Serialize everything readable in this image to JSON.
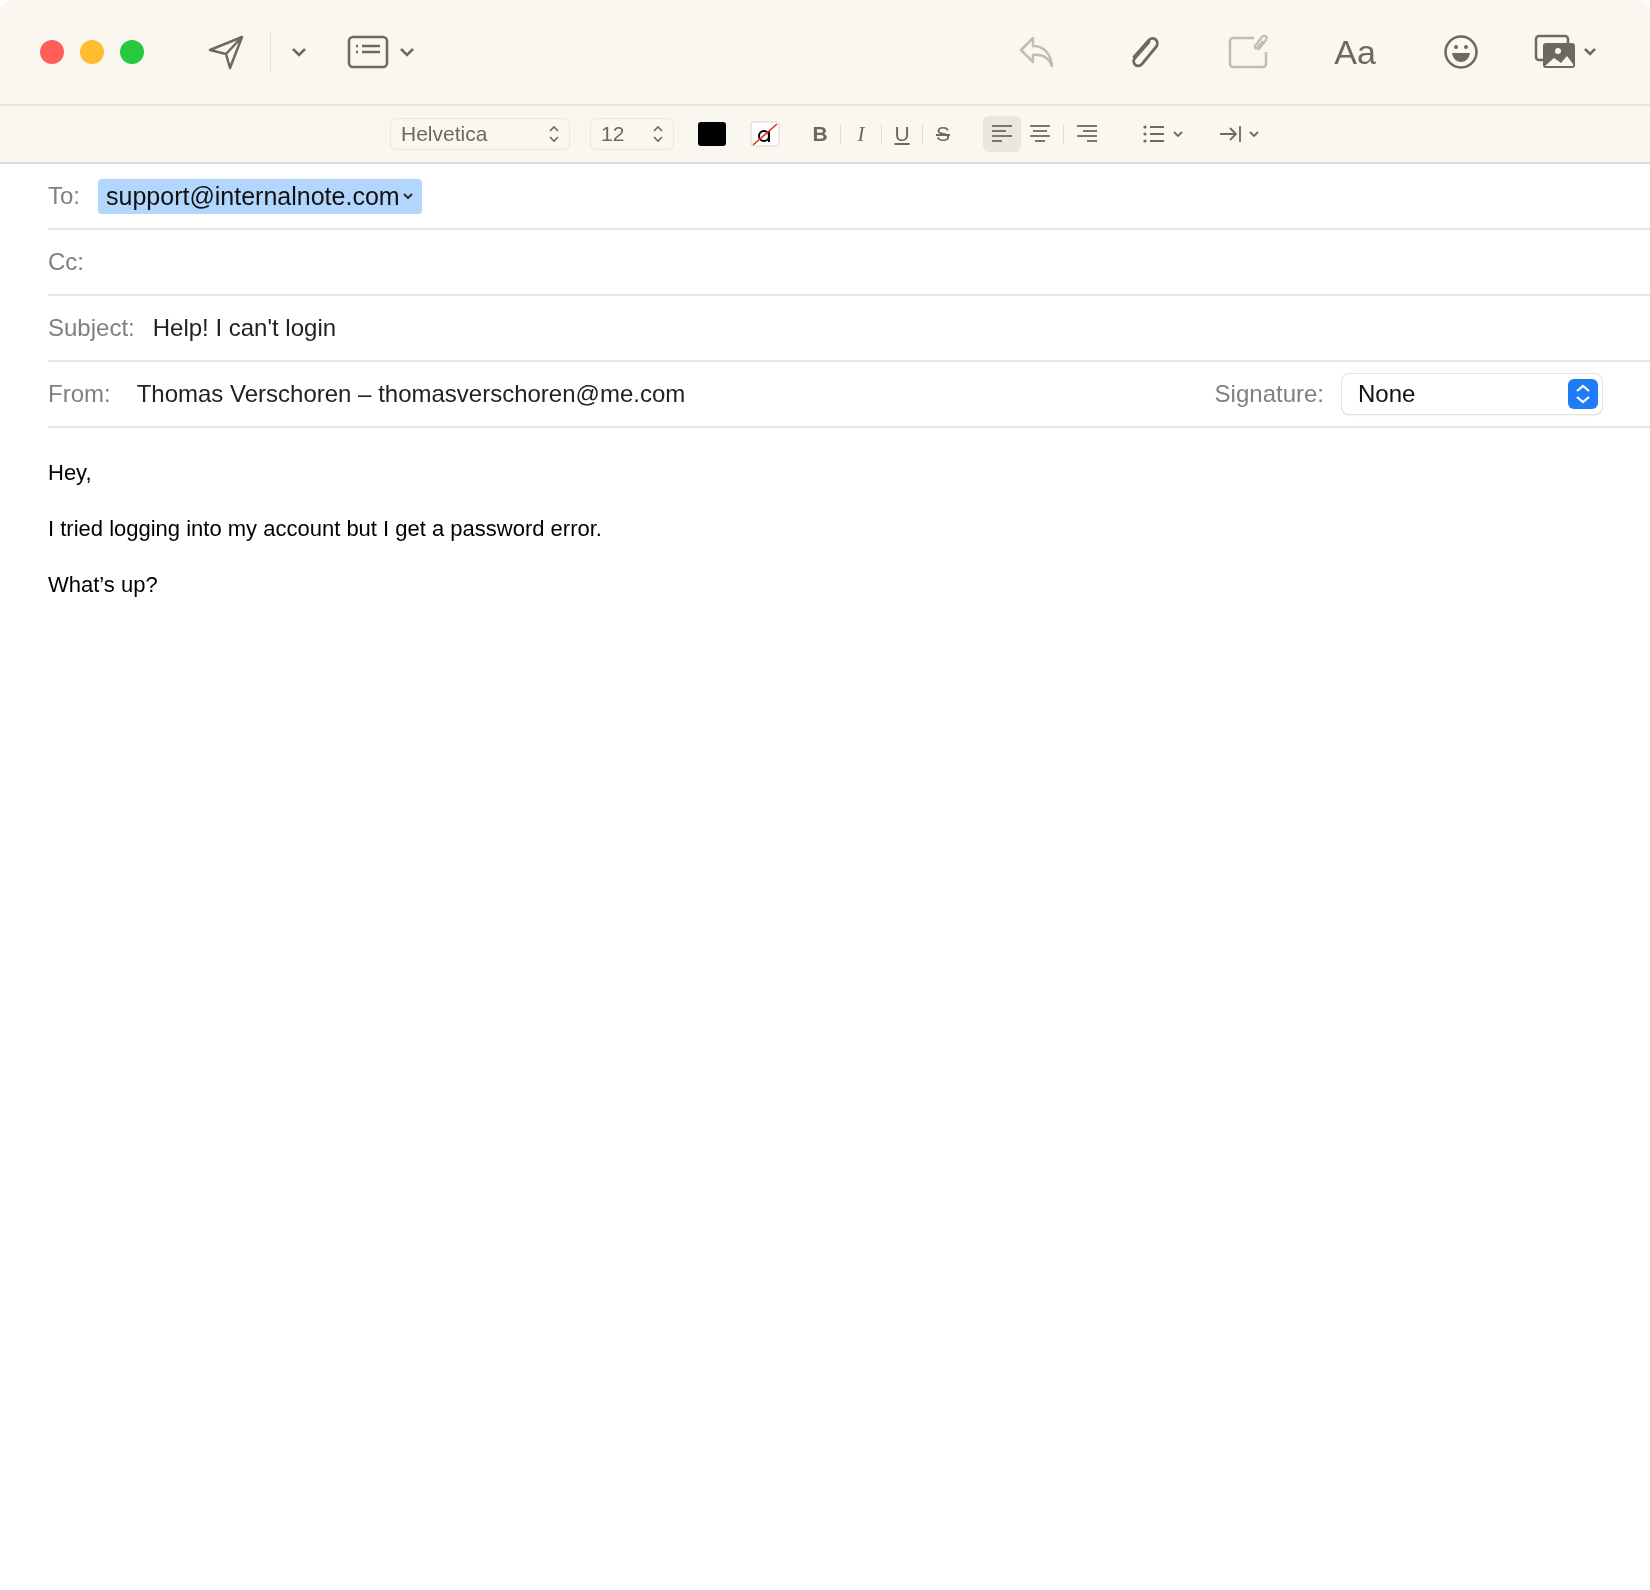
{
  "toolbar": {
    "buttons": [
      {
        "kind": "reply",
        "disabled": true
      },
      {
        "kind": "attach",
        "disabled": false
      },
      {
        "kind": "markup",
        "disabled": true
      },
      {
        "kind": "fonts",
        "label": "Aa",
        "disabled": false
      },
      {
        "kind": "emoji",
        "disabled": false
      },
      {
        "kind": "photo",
        "disabled": false
      }
    ]
  },
  "format_bar": {
    "font": "Helvetica",
    "size": "12",
    "styles": [
      {
        "kind": "bold",
        "label": "B"
      },
      {
        "kind": "italic",
        "label": "I"
      },
      {
        "kind": "underline",
        "label": "U"
      },
      {
        "kind": "strike",
        "label": "S"
      }
    ],
    "alignments": [
      {
        "kind": "left",
        "selected": true
      },
      {
        "kind": "center",
        "selected": false
      },
      {
        "kind": "right",
        "selected": false
      }
    ]
  },
  "header": {
    "to": {
      "label": "To:",
      "recipients": [
        {
          "address": "support@internalnote.com",
          "selected": true
        }
      ]
    },
    "cc": {
      "label": "Cc:"
    },
    "subject": {
      "label": "Subject:",
      "value": "Help! I can't login"
    },
    "from": {
      "label": "From:",
      "value": "Thomas Verschoren – thomasverschoren@me.com"
    },
    "signature": {
      "label": "Signature:",
      "value": "None"
    }
  },
  "body": [
    "Hey,",
    "I tried logging into my account but I get a password error.",
    "What’s up?"
  ]
}
